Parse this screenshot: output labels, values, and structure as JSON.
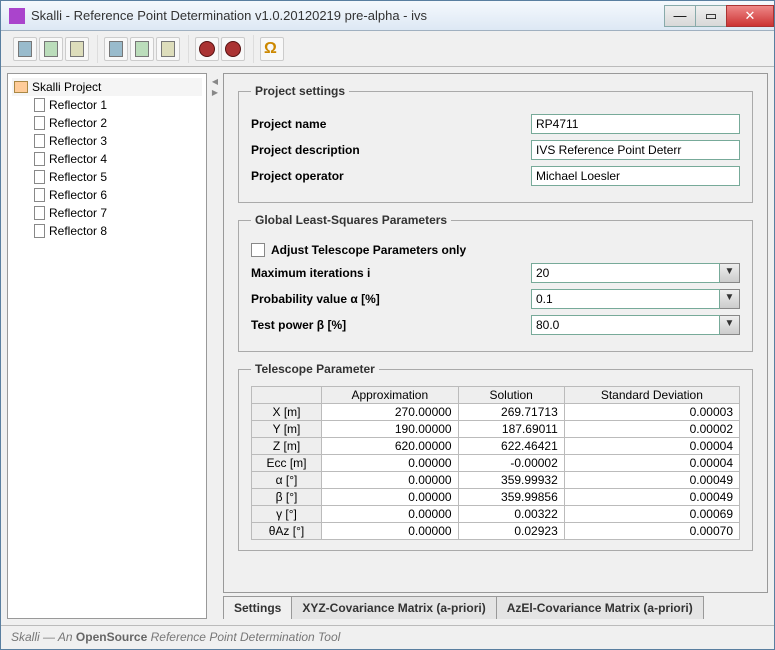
{
  "window": {
    "title": "Skalli - Reference Point Determination v1.0.20120219 pre-alpha - ivs"
  },
  "sidebar": {
    "root": "Skalli Project",
    "items": [
      "Reflector 1",
      "Reflector 2",
      "Reflector 3",
      "Reflector 4",
      "Reflector 5",
      "Reflector 6",
      "Reflector 7",
      "Reflector 8"
    ]
  },
  "legends": {
    "project": "Project settings",
    "glsp": "Global Least-Squares Parameters",
    "tel": "Telescope Parameter"
  },
  "project": {
    "name_label": "Project name",
    "name_value": "RP4711",
    "desc_label": "Project description",
    "desc_value": "IVS Reference Point Deterr",
    "op_label": "Project operator",
    "op_value": "Michael Loesler"
  },
  "glsp": {
    "adjust_label": "Adjust Telescope Parameters only",
    "maxit_label": "Maximum iterations i",
    "maxit_value": "20",
    "prob_label": "Probability value α [%]",
    "prob_value": "0.1",
    "pow_label": "Test power β [%]",
    "pow_value": "80.0"
  },
  "telhead": {
    "approx": "Approximation",
    "sol": "Solution",
    "std": "Standard Deviation"
  },
  "telrows": [
    {
      "h": "X [m]",
      "a": "270.00000",
      "s": "269.71713",
      "d": "0.00003"
    },
    {
      "h": "Y [m]",
      "a": "190.00000",
      "s": "187.69011",
      "d": "0.00002"
    },
    {
      "h": "Z [m]",
      "a": "620.00000",
      "s": "622.46421",
      "d": "0.00004"
    },
    {
      "h": "Ecc [m]",
      "a": "0.00000",
      "s": "-0.00002",
      "d": "0.00004"
    },
    {
      "h": "α [°]",
      "a": "0.00000",
      "s": "359.99932",
      "d": "0.00049"
    },
    {
      "h": "β [°]",
      "a": "0.00000",
      "s": "359.99856",
      "d": "0.00049"
    },
    {
      "h": "γ [°]",
      "a": "0.00000",
      "s": "0.00322",
      "d": "0.00069"
    },
    {
      "h": "θAz [°]",
      "a": "0.00000",
      "s": "0.02923",
      "d": "0.00070"
    }
  ],
  "tabs": {
    "t1": "Settings",
    "t2": "XYZ-Covariance Matrix (a-priori)",
    "t3": "AzEl-Covariance Matrix (a-priori)"
  },
  "status": {
    "pre": "Skalli — An ",
    "em": "OpenSource",
    "post": " Reference Point Determination Tool"
  }
}
